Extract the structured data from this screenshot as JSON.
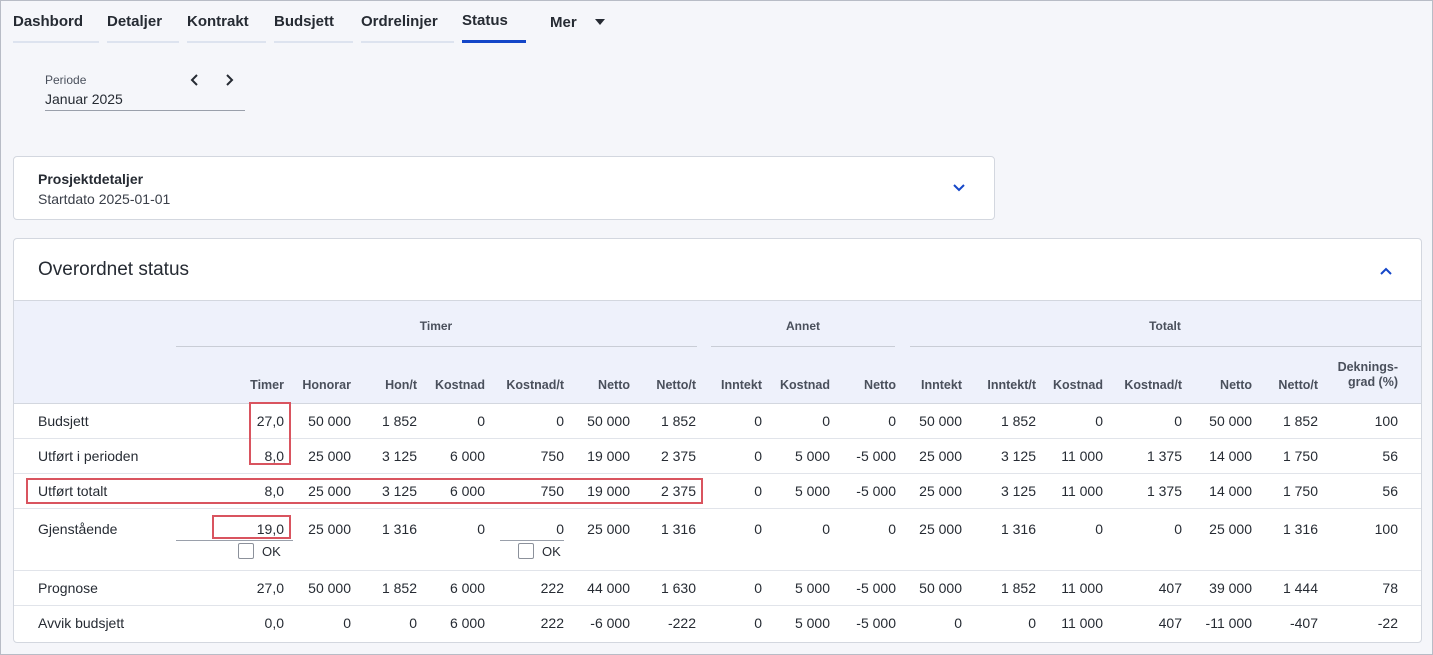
{
  "tabs": [
    {
      "label": "Dashbord"
    },
    {
      "label": "Detaljer"
    },
    {
      "label": "Kontrakt"
    },
    {
      "label": "Budsjett"
    },
    {
      "label": "Ordrelinjer"
    },
    {
      "label": "Status",
      "active": true
    }
  ],
  "more_tab": {
    "label": "Mer"
  },
  "periode": {
    "label": "Periode",
    "value": "Januar 2025"
  },
  "project_details": {
    "title": "Prosjektdetaljer",
    "subtitle": "Startdato 2025-01-01"
  },
  "status": {
    "title": "Overordnet status",
    "groups": [
      "Timer",
      "Annet",
      "Totalt"
    ],
    "columns": [
      "Timer",
      "Honorar",
      "Hon/t",
      "Kostnad",
      "Kostnad/t",
      "Netto",
      "Netto/t",
      "Inntekt",
      "Kostnad",
      "Netto",
      "Inntekt",
      "Inntekt/t",
      "Kostnad",
      "Kostnad/t",
      "Netto",
      "Netto/t"
    ],
    "last_col_line1": "Deknings-",
    "last_col_line2": "grad (%)",
    "ok_label": "OK",
    "rows": [
      {
        "label": "Budsjett",
        "values": [
          "27,0",
          "50 000",
          "1 852",
          "0",
          "0",
          "50 000",
          "1 852",
          "0",
          "0",
          "0",
          "50 000",
          "1 852",
          "0",
          "0",
          "50 000",
          "1 852",
          "100"
        ]
      },
      {
        "label": "Utført i perioden",
        "values": [
          "8,0",
          "25 000",
          "3 125",
          "6 000",
          "750",
          "19 000",
          "2 375",
          "0",
          "5 000",
          "-5 000",
          "25 000",
          "3 125",
          "11 000",
          "1 375",
          "14 000",
          "1 750",
          "56"
        ]
      },
      {
        "label": "Utført totalt",
        "values": [
          "8,0",
          "25 000",
          "3 125",
          "6 000",
          "750",
          "19 000",
          "2 375",
          "0",
          "5 000",
          "-5 000",
          "25 000",
          "3 125",
          "11 000",
          "1 375",
          "14 000",
          "1 750",
          "56"
        ]
      },
      {
        "label": "Gjenstående",
        "values": [
          "19,0",
          "25 000",
          "1 316",
          "0",
          "0",
          "25 000",
          "1 316",
          "0",
          "0",
          "0",
          "25 000",
          "1 316",
          "0",
          "0",
          "25 000",
          "1 316",
          "100"
        ]
      },
      {
        "label": "Prognose",
        "values": [
          "27,0",
          "50 000",
          "1 852",
          "6 000",
          "222",
          "44 000",
          "1 630",
          "0",
          "5 000",
          "-5 000",
          "50 000",
          "1 852",
          "11 000",
          "407",
          "39 000",
          "1 444",
          "78"
        ]
      },
      {
        "label": "Avvik budsjett",
        "values": [
          "0,0",
          "0",
          "0",
          "6 000",
          "222",
          "-6 000",
          "-222",
          "0",
          "5 000",
          "-5 000",
          "0",
          "0",
          "11 000",
          "407",
          "-11 000",
          "-407",
          "-22"
        ]
      }
    ]
  }
}
